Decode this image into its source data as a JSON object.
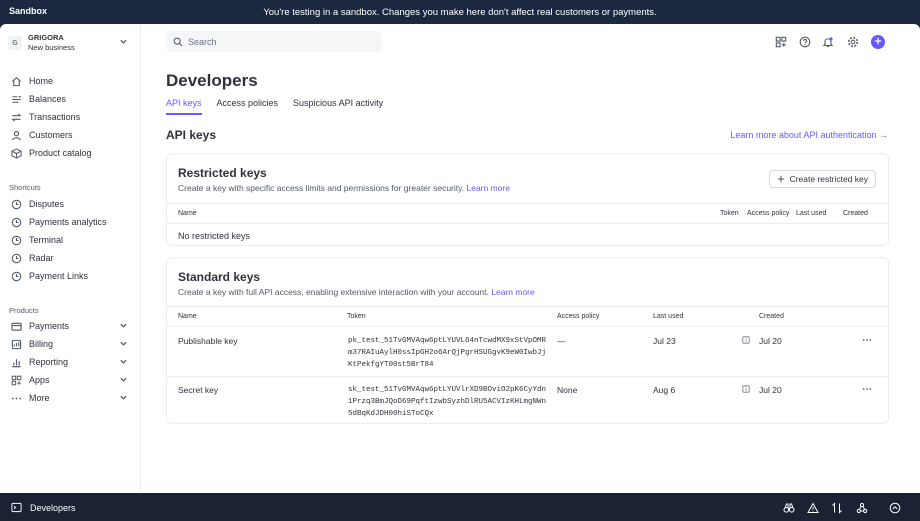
{
  "banner": {
    "tag": "Sandbox",
    "message": "You're testing in a sandbox. Changes you make here don't affect real customers or payments."
  },
  "business": {
    "initial": "G",
    "name": "GRIGORA",
    "subtitle": "New business"
  },
  "nav": {
    "main": [
      "Home",
      "Balances",
      "Transactions",
      "Customers",
      "Product catalog"
    ],
    "shortcuts_title": "Shortcuts",
    "shortcuts": [
      "Disputes",
      "Payments analytics",
      "Terminal",
      "Radar",
      "Payment Links"
    ],
    "products_title": "Products",
    "products": [
      "Payments",
      "Billing",
      "Reporting",
      "Apps",
      "More"
    ]
  },
  "search": {
    "placeholder": "Search"
  },
  "page": {
    "title": "Developers",
    "tabs": [
      "API keys",
      "Access policies",
      "Suspicious API activity"
    ],
    "section_title": "API keys",
    "learn_more_auth": "Learn more about API authentication →"
  },
  "restricted": {
    "title": "Restricted keys",
    "desc": "Create a key with specific access limits and permissions for greater security.",
    "link": "Learn more",
    "button": "Create restricted key",
    "columns": {
      "name": "Name",
      "token": "Token",
      "policy": "Access policy",
      "last_used": "Last used",
      "created": "Created"
    },
    "empty": "No restricted keys"
  },
  "standard": {
    "title": "Standard keys",
    "desc": "Create a key with full API access, enabling extensive interaction with your account.",
    "link": "Learn more",
    "columns": {
      "name": "Name",
      "token": "Token",
      "policy": "Access policy",
      "last_used": "Last used",
      "created": "Created"
    },
    "rows": [
      {
        "name": "Publishable key",
        "token": "pk_test_51TvGMVAqw6ptLYUVL64nTcwdMX9xStVpOMRm37RAIuAylH0ssIpGH2o6ArQjPgrHSUGgvK9eW0IwbJjKtPekfgYT00st5BrT84",
        "policy": "—",
        "last_used": "Jul 23",
        "created": "Jul 20"
      },
      {
        "name": "Secret key",
        "token": "sk_test_51TvGMVAqw6ptLYUVlrXD9BOviO2pK6CyYdn1Przq3BmJQoD69PqftIzwbSyzhDlRU5ACVIzKHLmgNWn5dBqKdJDH00hiSToCQx",
        "policy": "None",
        "last_used": "Aug 6",
        "created": "Jul 20"
      }
    ]
  },
  "bottombar": {
    "label": "Developers"
  },
  "colors": {
    "accent": "#635bff",
    "banner": "#1c2840"
  }
}
